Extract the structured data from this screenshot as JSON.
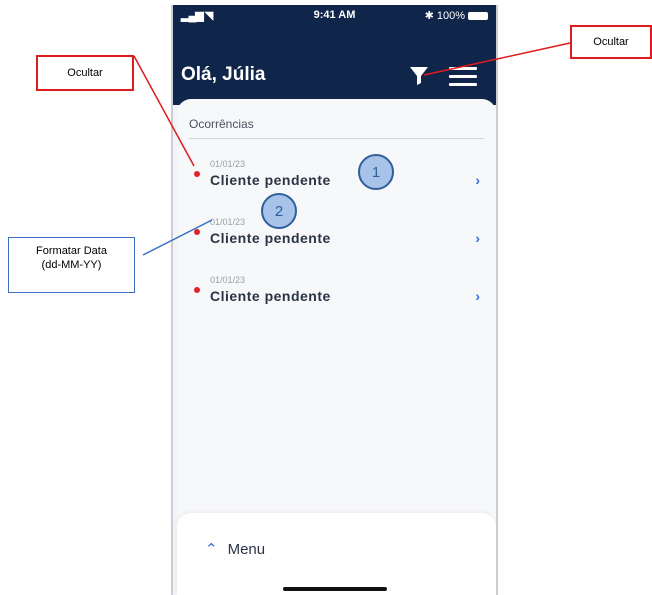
{
  "status_bar": {
    "signal": "▂▄▆ ◥",
    "time": "9:41 AM",
    "battery": "✱ 100%"
  },
  "header": {
    "greeting": "Olá, Júlia"
  },
  "section": {
    "title": "Ocorrências"
  },
  "items": [
    {
      "date": "01/01/23",
      "title": "Cliente pendente"
    },
    {
      "date": "01/01/23",
      "title": "Cliente pendente"
    },
    {
      "date": "01/01/23",
      "title": "Cliente pendente"
    }
  ],
  "bottom_menu": {
    "label": "Menu"
  },
  "annotations": {
    "hide_left": "Ocultar",
    "hide_right": "Ocultar",
    "format_date_line1": "Formatar Data",
    "format_date_line2": "(dd-MM-YY)",
    "badge1": "1",
    "badge2": "2"
  },
  "colors": {
    "header_bg": "#0f2549",
    "dot": "#e0222c",
    "accent": "#2f6de0",
    "annotation_red": "#e01b1b",
    "annotation_blue": "#3a6fc4"
  }
}
